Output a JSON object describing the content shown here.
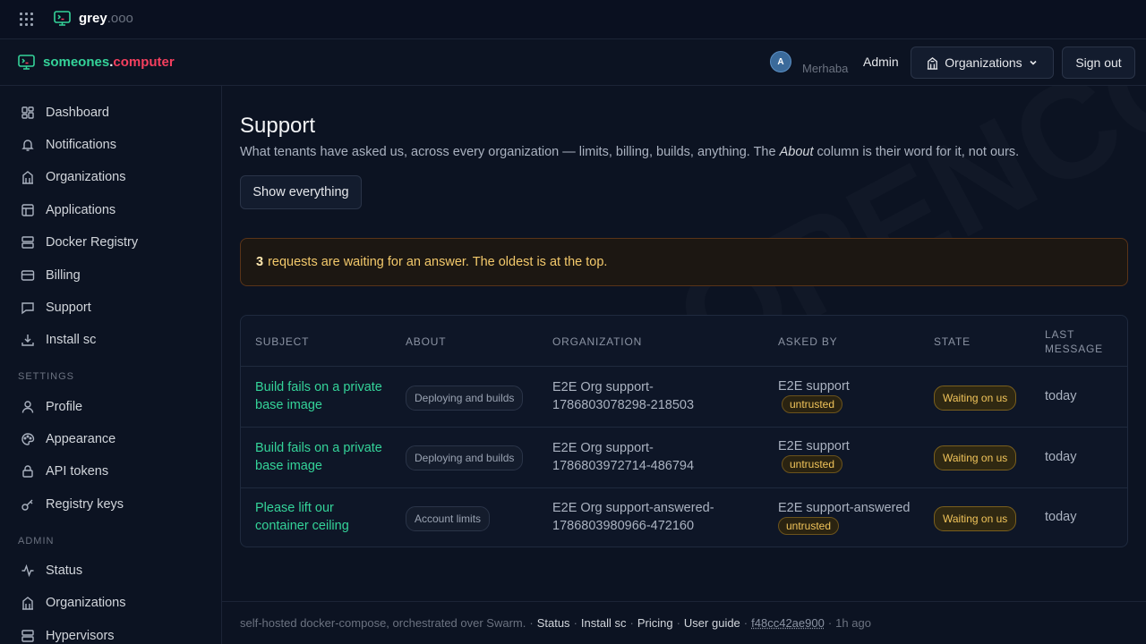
{
  "topbar": {
    "brand_name": "grey",
    "brand_suffix": ".ooo"
  },
  "appbar": {
    "site_part1": "someones",
    "site_dot": ".",
    "site_part2": "computer",
    "avatar_initial": "A",
    "greeting": "Merhaba",
    "user_name": "Admin",
    "orgs_label": "Organizations",
    "signout_label": "Sign out"
  },
  "sidebar": {
    "main_items": [
      {
        "label": "Dashboard",
        "icon": "dashboard-icon"
      },
      {
        "label": "Notifications",
        "icon": "bell-icon"
      },
      {
        "label": "Organizations",
        "icon": "building-icon"
      },
      {
        "label": "Applications",
        "icon": "layout-icon"
      },
      {
        "label": "Docker Registry",
        "icon": "server-icon"
      },
      {
        "label": "Billing",
        "icon": "credit-card-icon"
      },
      {
        "label": "Support",
        "icon": "chat-icon"
      },
      {
        "label": "Install sc",
        "icon": "download-icon"
      }
    ],
    "settings_heading": "SETTINGS",
    "settings_items": [
      {
        "label": "Profile",
        "icon": "user-icon"
      },
      {
        "label": "Appearance",
        "icon": "palette-icon"
      },
      {
        "label": "API tokens",
        "icon": "lock-icon"
      },
      {
        "label": "Registry keys",
        "icon": "key-icon"
      }
    ],
    "admin_heading": "ADMIN",
    "admin_items": [
      {
        "label": "Status",
        "icon": "activity-icon"
      },
      {
        "label": "Organizations",
        "icon": "building-icon"
      },
      {
        "label": "Hypervisors",
        "icon": "server-icon"
      }
    ]
  },
  "page": {
    "title": "Support",
    "desc_before": "What tenants have asked us, across every organization — limits, billing, builds, anything. The",
    "desc_em": "About",
    "desc_after": "column is their word for it, not ours.",
    "show_all_label": "Show everything",
    "notice_count": "3",
    "notice_text": "requests are waiting for an answer. The oldest is at the top.",
    "watermark": "OPENCOMPUTER"
  },
  "table": {
    "headers": [
      "SUBJECT",
      "ABOUT",
      "ORGANIZATION",
      "ASKED BY",
      "STATE",
      "LAST MESSAGE"
    ],
    "rows": [
      {
        "subject": "Build fails on a private base image",
        "about": "Deploying and builds",
        "org": "E2E Org support-1786803078298-218503",
        "asked_by": "E2E support",
        "trust": "untrusted",
        "state": "Waiting on us",
        "last": "today"
      },
      {
        "subject": "Build fails on a private base image",
        "about": "Deploying and builds",
        "org": "E2E Org support-1786803972714-486794",
        "asked_by": "E2E support",
        "trust": "untrusted",
        "state": "Waiting on us",
        "last": "today"
      },
      {
        "subject": "Please lift our container ceiling",
        "about": "Account limits",
        "org": "E2E Org support-answered-1786803980966-472160",
        "asked_by": "E2E support-answered",
        "trust": "untrusted",
        "state": "Waiting on us",
        "last": "today"
      }
    ]
  },
  "footer": {
    "text": "self-hosted docker-compose, orchestrated over Swarm.",
    "links": [
      "Status",
      "Install sc",
      "Pricing",
      "User guide"
    ],
    "commit": "f48cc42ae900",
    "age": "1h ago"
  },
  "colors": {
    "accent": "#34d399",
    "brand_red": "#f43f5e",
    "warning": "#f1c45a",
    "background": "#0c1322"
  }
}
